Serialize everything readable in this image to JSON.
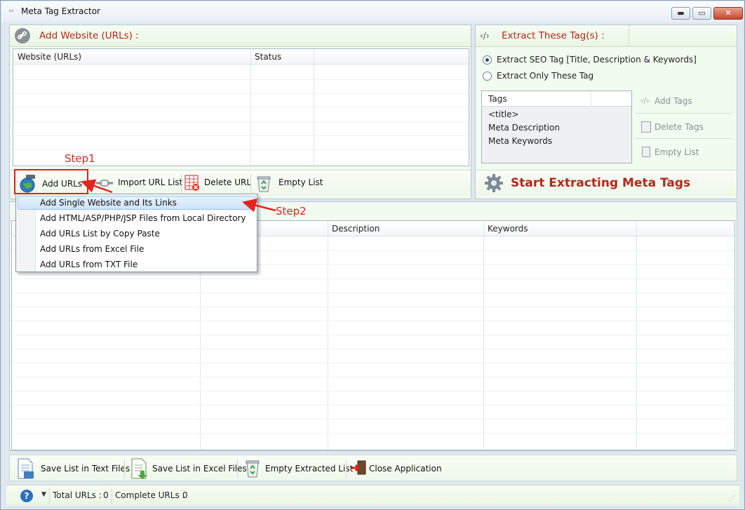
{
  "window": {
    "title": "Meta Tag Extractor",
    "min_glyph": "▬",
    "max_glyph": "▭",
    "close_glyph": "✕"
  },
  "website_pane": {
    "title": "Add Website (URLs) :",
    "columns": [
      "Website (URLs)",
      "Status"
    ]
  },
  "toolbar": {
    "add_urls": "Add URLs",
    "import_url_list": "Import URL List",
    "delete_url": "Delete URL",
    "empty_list": "Empty List"
  },
  "dropdown": {
    "items": [
      "Add Single Website and Its Links",
      "Add HTML/ASP/PHP/JSP Files from Local Directory",
      "Add URLs List by Copy Paste",
      "Add URLs from Excel File",
      "Add URLs from TXT File"
    ],
    "highlighted_index": 0
  },
  "annotations": {
    "step1": "Step1",
    "step2": "Step2"
  },
  "tags_pane": {
    "title": "Extract These Tag(s) :",
    "radio_seo": "Extract SEO Tag [Title, Description & Keywords]",
    "radio_only": "Extract Only These Tag",
    "selected_radio": "seo",
    "tags_header": "Tags",
    "tags": [
      "<title>",
      "Meta Description",
      "Meta Keywords"
    ],
    "add_tags": "Add Tags",
    "delete_tags": "Delete Tags",
    "empty_list": "Empty List"
  },
  "start_button": "Start Extracting Meta Tags",
  "results": {
    "columns": [
      "Description",
      "Keywords"
    ]
  },
  "bottom_toolbar": {
    "save_text": "Save List in Text Files",
    "save_excel": "Save List in Excel Files",
    "empty_extracted": "Empty Extracted List",
    "close_app": "Close Application"
  },
  "status_bar": {
    "total_urls_label": "Total URLs :",
    "total_urls_value": "0",
    "complete_urls_label": "Complete URLs :",
    "complete_urls_value": "0"
  },
  "colors": {
    "accent_red": "#b3291b",
    "annotation_red": "#e5231f",
    "panel_green": "#f2fbf0"
  }
}
